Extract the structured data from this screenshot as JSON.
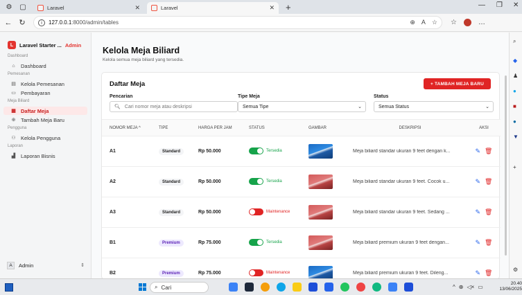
{
  "browser": {
    "tabs": [
      {
        "title": "Laravel"
      },
      {
        "title": "Laravel"
      }
    ],
    "url_host": "127.0.0.1",
    "url_path": ":8000/admin/tables"
  },
  "sidebar": {
    "brand": "Laravel Starter ...",
    "brand_badge": "Admin",
    "sections": [
      {
        "label": "Dashboard",
        "items": [
          {
            "label": "Dashboard",
            "icon": "home-icon"
          }
        ]
      },
      {
        "label": "Pemesanan",
        "items": [
          {
            "label": "Kelola Pemesanan",
            "icon": "calendar-icon"
          },
          {
            "label": "Pembayaran",
            "icon": "card-icon"
          }
        ]
      },
      {
        "label": "Meja Biliard",
        "items": [
          {
            "label": "Daftar Meja",
            "icon": "table-icon",
            "active": true
          },
          {
            "label": "Tambah Meja Baru",
            "icon": "plus-circle-icon"
          }
        ]
      },
      {
        "label": "Pengguna",
        "items": [
          {
            "label": "Kelola Pengguna",
            "icon": "users-icon"
          }
        ]
      },
      {
        "label": "Laporan",
        "items": [
          {
            "label": "Laporan Bisnis",
            "icon": "bar-chart-icon"
          }
        ]
      }
    ],
    "user": {
      "initial": "A",
      "name": "Admin"
    }
  },
  "page": {
    "title": "Kelola Meja Biliard",
    "subtitle": "Kelola semua meja biliard yang tersedia."
  },
  "card": {
    "title": "Daftar Meja",
    "add_button": "+ TAMBAH MEJA BARU",
    "filters": {
      "search_label": "Pencarian",
      "search_placeholder": "Cari nomor meja atau deskripsi",
      "type_label": "Tipe Meja",
      "type_value": "Semua Tipe",
      "status_label": "Status",
      "status_value": "Semua Status"
    }
  },
  "table": {
    "headers": {
      "no": "NOMOR MEJA ^",
      "tipe": "TIPE",
      "harga": "HARGA PER JAM",
      "status": "STATUS",
      "gambar": "GAMBAR",
      "deskripsi": "DESKRIPSI",
      "aksi": "AKSI"
    },
    "rows": [
      {
        "no": "A1",
        "tipe": "Standard",
        "harga": "Rp 50.000",
        "status": "Tersedia",
        "on": true,
        "img": "blue",
        "desk": "Meja biliard standar ukuran 9 feet dengan k..."
      },
      {
        "no": "A2",
        "tipe": "Standard",
        "harga": "Rp 50.000",
        "status": "Tersedia",
        "on": true,
        "img": "red",
        "desk": "Meja biliard standar ukuran 9 feet. Cocok u..."
      },
      {
        "no": "A3",
        "tipe": "Standard",
        "harga": "Rp 50.000",
        "status": "Maintenance",
        "on": false,
        "img": "red",
        "desk": "Meja biliard standar ukuran 9 feet. Sedang ..."
      },
      {
        "no": "B1",
        "tipe": "Premium",
        "harga": "Rp 75.000",
        "status": "Tersedia",
        "on": true,
        "img": "red",
        "desk": "Meja biliard premium ukuran 9 feet dengan..."
      },
      {
        "no": "B2",
        "tipe": "Premium",
        "harga": "Rp 75.000",
        "status": "Maintenance",
        "on": false,
        "img": "blue",
        "desk": "Meja biliard premium ukuran 9 feet. Dileng..."
      }
    ]
  },
  "taskbar": {
    "search": "Cari",
    "time": "20.40",
    "date": "13/06/2025"
  },
  "colors": {
    "accent": "#e02424",
    "success": "#16a34a",
    "premium_badge": "#ede9fe"
  }
}
